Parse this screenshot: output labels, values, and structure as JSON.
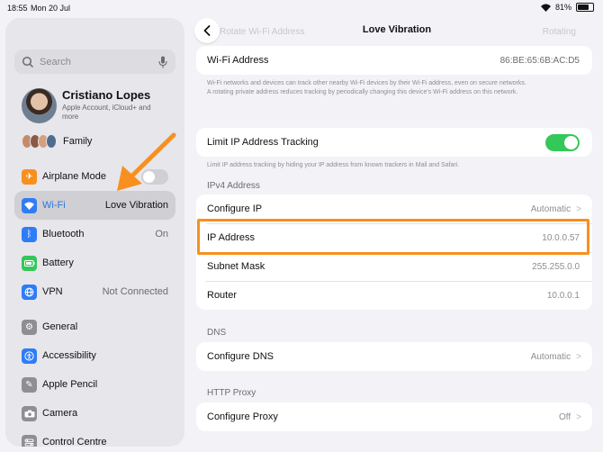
{
  "status_bar": {
    "time": "18:55",
    "date": "Mon 20 Jul",
    "battery": "81%"
  },
  "sidebar": {
    "search_placeholder": "Search",
    "profile": {
      "name": "Cristiano Lopes",
      "subtitle": "Apple Account, iCloud+ and more"
    },
    "family_label": "Family",
    "items": [
      {
        "label": "Airplane Mode",
        "value": "",
        "icon": "airplane-icon",
        "color": "#f7901e",
        "toggle": false
      },
      {
        "label": "Wi-Fi",
        "value": "Love Vibration",
        "icon": "wifi-icon",
        "color": "#2f7cf6",
        "selected": true
      },
      {
        "label": "Bluetooth",
        "value": "On",
        "icon": "bluetooth-icon",
        "color": "#2f7cf6"
      },
      {
        "label": "Battery",
        "value": "",
        "icon": "battery-icon",
        "color": "#34c759"
      },
      {
        "label": "VPN",
        "value": "Not Connected",
        "icon": "vpn-icon",
        "color": "#2f7cf6"
      },
      {
        "label": "General",
        "value": "",
        "icon": "gear-icon",
        "color": "#8e8e93"
      },
      {
        "label": "Accessibility",
        "value": "",
        "icon": "accessibility-icon",
        "color": "#2f7cf6"
      },
      {
        "label": "Apple Pencil",
        "value": "",
        "icon": "pencil-icon",
        "color": "#8e8e93"
      },
      {
        "label": "Camera",
        "value": "",
        "icon": "camera-icon",
        "color": "#8e8e93"
      },
      {
        "label": "Control Centre",
        "value": "",
        "icon": "control-centre-icon",
        "color": "#8e8e93"
      }
    ]
  },
  "nav": {
    "title": "Love Vibration",
    "ghost_left": "Rotate Wi-Fi Address",
    "ghost_right": "Rotating"
  },
  "wifi_address": {
    "label": "Wi-Fi Address",
    "value": "86:BE:65:6B:AC:D5"
  },
  "wifi_note": "Wi-Fi networks and devices can track other nearby Wi-Fi devices by their Wi-Fi address, even on secure networks.\nA rotating private address reduces tracking by periodically changing this device's Wi-Fi address on this network.",
  "limit_tracking": {
    "label": "Limit IP Address Tracking",
    "on": true
  },
  "limit_note": "Limit IP address tracking by hiding your IP address from known trackers in Mail and Safari.",
  "ipv4": {
    "header": "IPv4 Address",
    "rows": [
      {
        "label": "Configure IP",
        "value": "Automatic",
        "chevron": true
      },
      {
        "label": "IP Address",
        "value": "10.0.0.57"
      },
      {
        "label": "Subnet Mask",
        "value": "255.255.0.0"
      },
      {
        "label": "Router",
        "value": "10.0.0.1"
      }
    ]
  },
  "dns": {
    "header": "DNS",
    "row": {
      "label": "Configure DNS",
      "value": "Automatic"
    }
  },
  "proxy": {
    "header": "HTTP Proxy",
    "row": {
      "label": "Configure Proxy",
      "value": "Off"
    }
  },
  "annotation_color": "#f7901e"
}
